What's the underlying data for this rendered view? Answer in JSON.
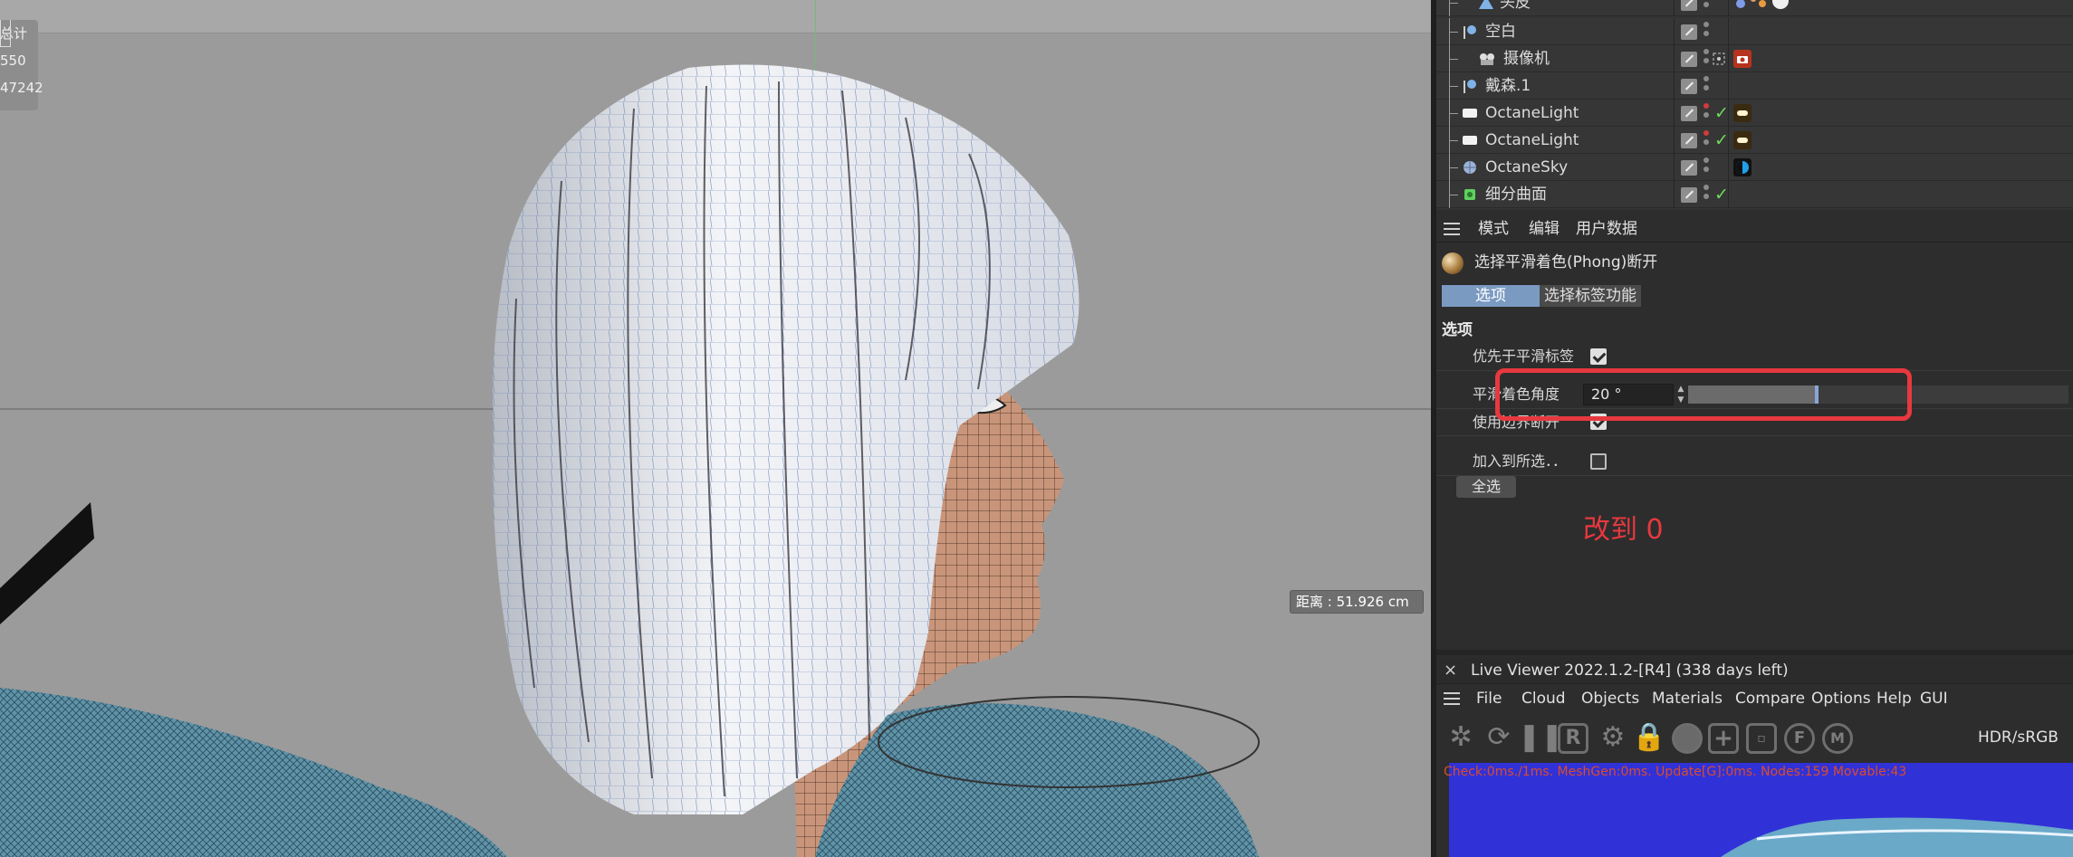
{
  "viewport": {
    "stats": [
      "总计",
      "550",
      "47242"
    ],
    "distance": "距离 : 51.926 cm"
  },
  "objects": [
    {
      "name": "头皮",
      "icon_color": "#7fb3e8",
      "dot1": "red",
      "check": false,
      "tag": "sphere-tags-icon"
    },
    {
      "name": "空白",
      "icon_color": "#7fb3e8",
      "dot1": "gray",
      "check": false,
      "tag": ""
    },
    {
      "name": "摄像机",
      "icon_color": "#dddddd",
      "dot1": "gray",
      "check": false,
      "tag": "camera-tag-icon"
    },
    {
      "name": "戴森.1",
      "icon_color": "#7fb3e8",
      "dot1": "gray",
      "check": false,
      "tag": ""
    },
    {
      "name": "OctaneLight",
      "icon_color": "#ffffff",
      "dot1": "red",
      "check": true,
      "tag": "light-tag-icon"
    },
    {
      "name": "OctaneLight",
      "icon_color": "#ffffff",
      "dot1": "red",
      "check": true,
      "tag": "light-tag-icon"
    },
    {
      "name": "OctaneSky",
      "icon_color": "#9bb3d6",
      "dot1": "gray",
      "check": false,
      "tag": "sky-tag-icon"
    },
    {
      "name": "细分曲面",
      "icon_color": "#5fcf5f",
      "dot1": "gray",
      "check": true,
      "tag": ""
    }
  ],
  "attributes": {
    "menu": [
      "模式",
      "编辑",
      "用户数据"
    ],
    "tag_title": "选择平滑着色(Phong)断开",
    "tabs": [
      "选项",
      "选择标签功能"
    ],
    "section": "选项",
    "rows": {
      "prefer_smooth": {
        "label": "优先于平滑标签",
        "checked": true
      },
      "smooth_angle": {
        "label": "平滑着色角度",
        "value": "20 °",
        "slider_fraction": 0.333
      },
      "use_edge_break": {
        "label": "使用边界断开",
        "checked": true
      },
      "add_to_selection": {
        "label": "加入到所选．．",
        "checked": false
      }
    },
    "select_all": "全选",
    "annotation": "改到 0"
  },
  "live_viewer": {
    "close": "×",
    "title": "Live Viewer 2022.1.2-[R4] (338 days left)",
    "menu": [
      "File",
      "Cloud",
      "Objects",
      "Materials",
      "Compare",
      "Options",
      "Help",
      "GUI"
    ],
    "color_mode": "HDR/sRGB",
    "status": "Check:0ms./1ms. MeshGen:0ms. Update[G]:0ms. Nodes:159 Movable:43"
  }
}
